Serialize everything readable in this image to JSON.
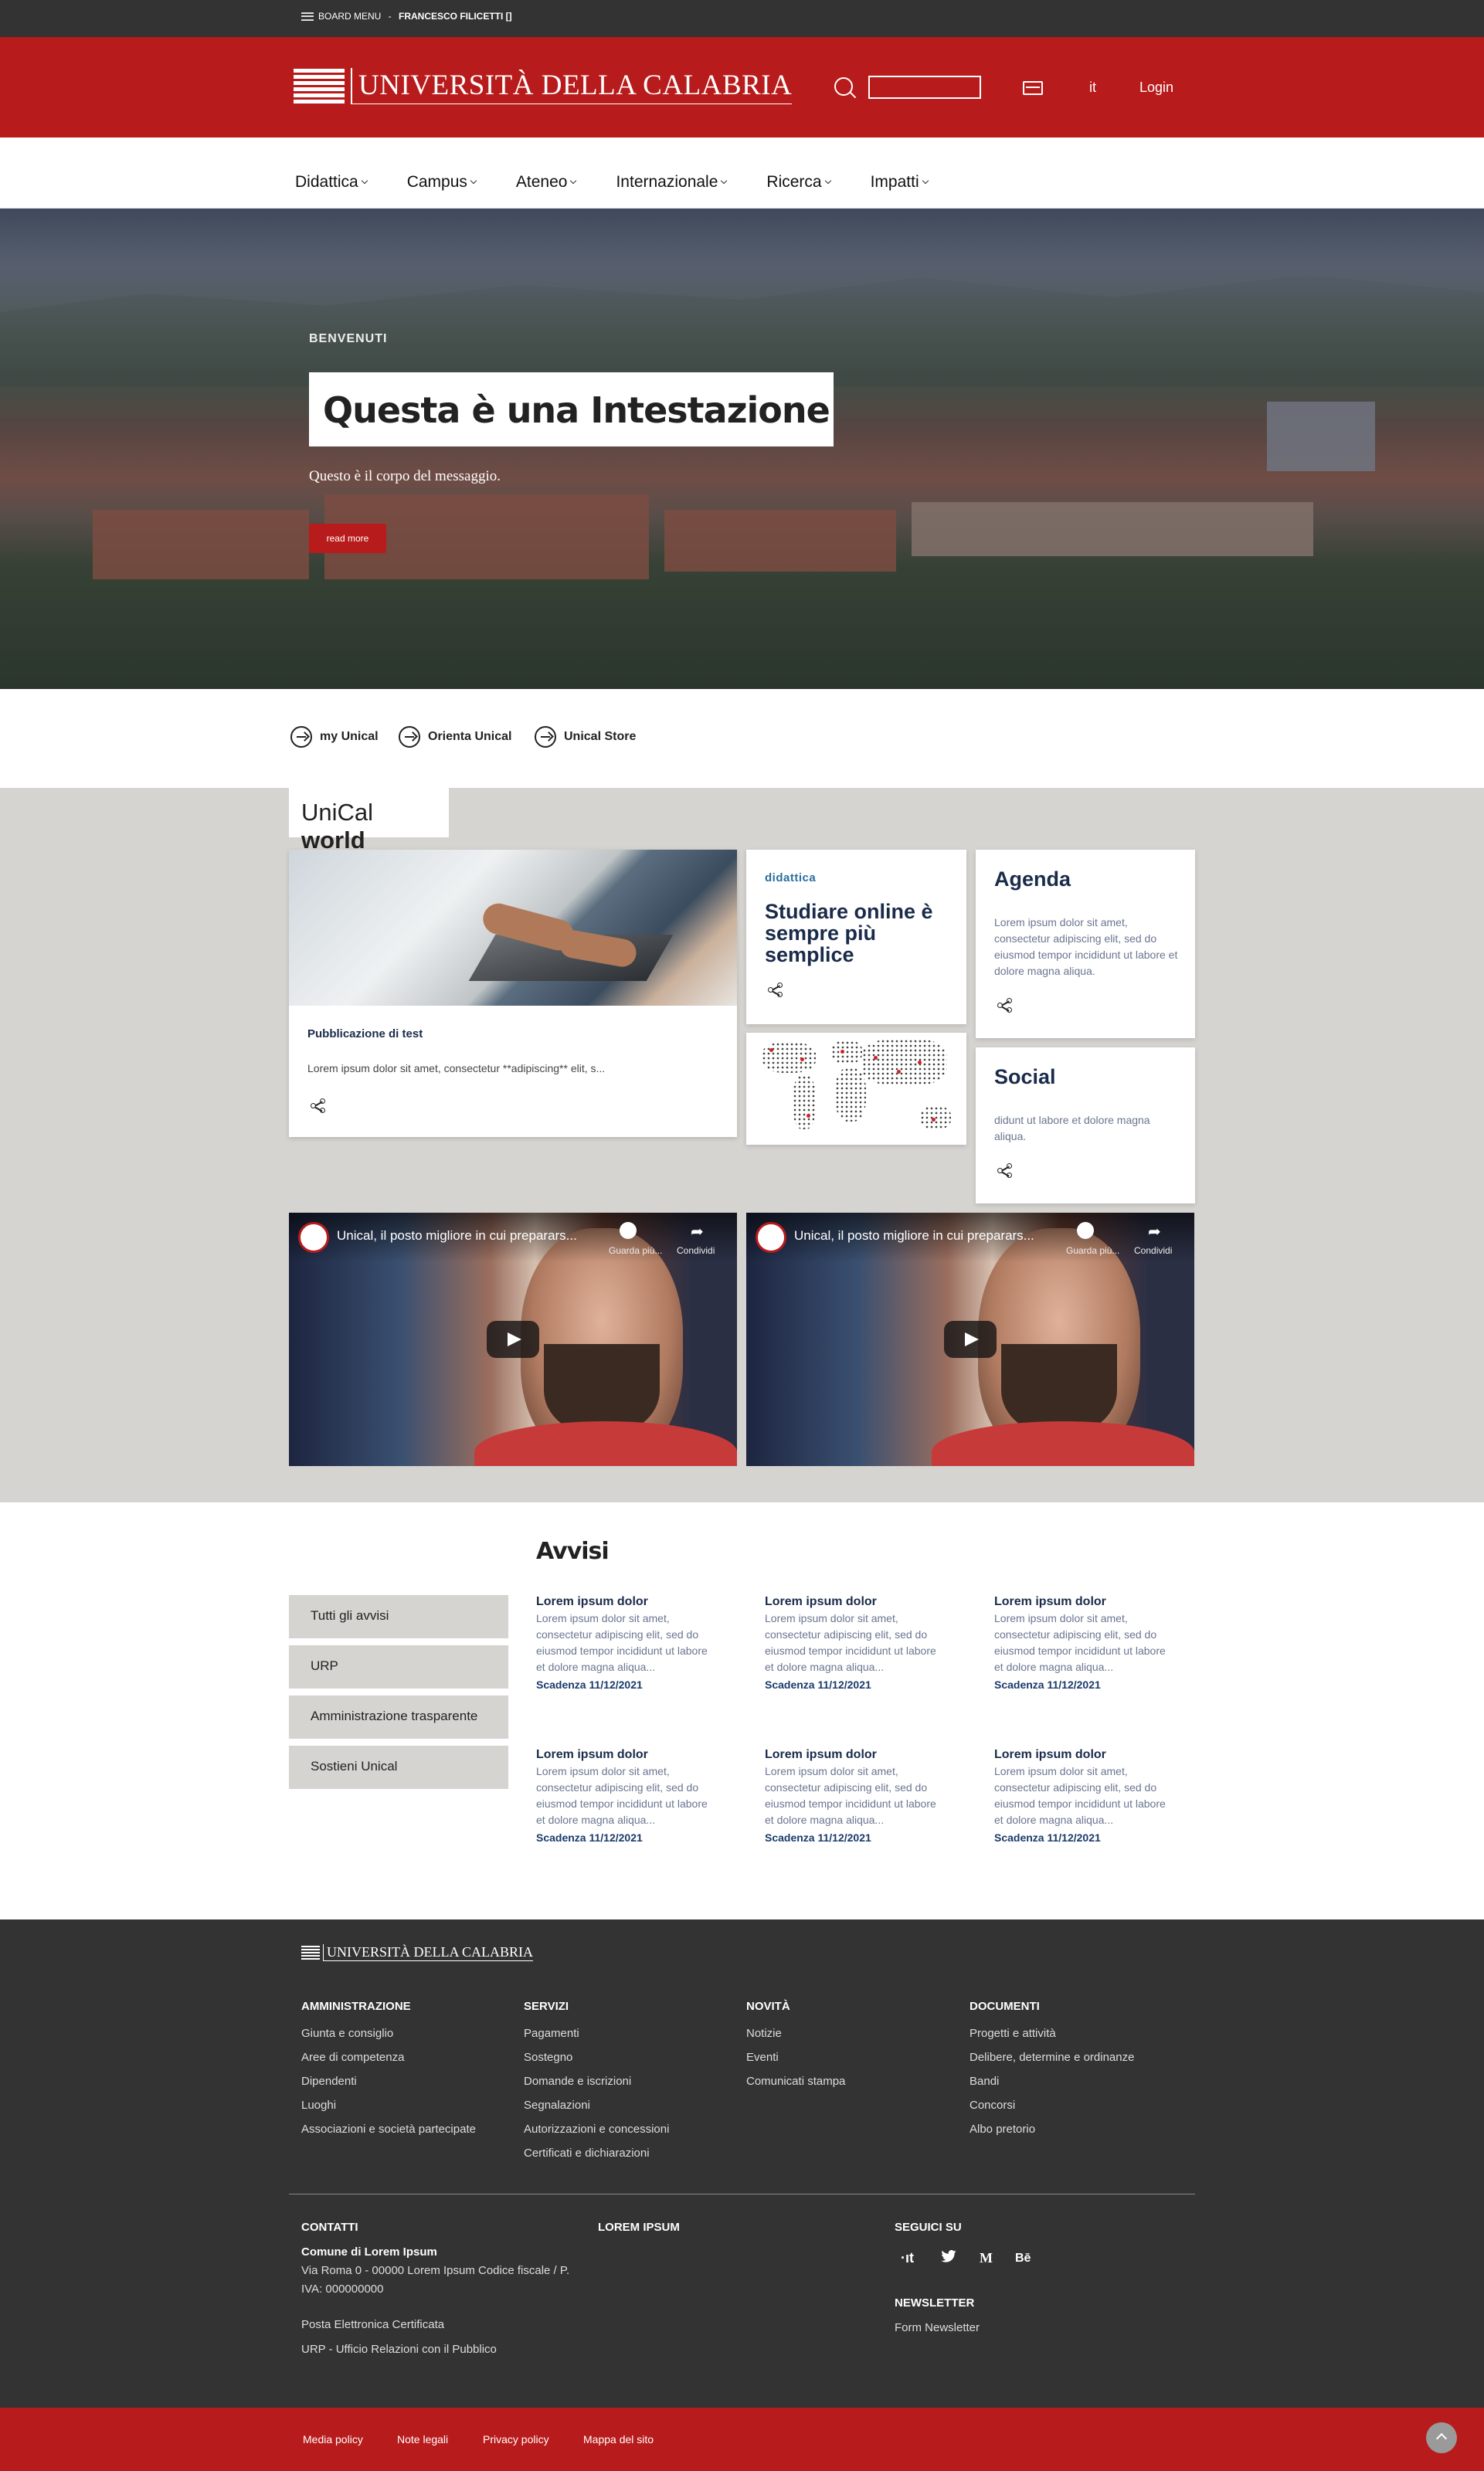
{
  "topbar": {
    "menu_label": "BOARD MENU",
    "separator": " - ",
    "user": "FRANCESCO FILICETTI []"
  },
  "header": {
    "brand": "UNIVERSITÀ DELLA CALABRIA",
    "search_placeholder": "",
    "lang": "it",
    "login": "Login"
  },
  "nav": {
    "items": [
      "Didattica",
      "Campus",
      "Ateneo",
      "Internazionale",
      "Ricerca",
      "Impatti"
    ]
  },
  "hero": {
    "kicker": "BENVENUTI",
    "title": "Questa è una Intestazione",
    "body": "Questo è il corpo del messaggio.",
    "button": "read more"
  },
  "quick_links": [
    "my Unical",
    "Orienta Unical",
    "Unical Store"
  ],
  "world": {
    "title_light": "UniCal",
    "title_bold": "world",
    "card_pub": {
      "title": "Pubblicazione di test",
      "body": "Lorem ipsum dolor sit amet, consectetur **adipiscing** elit, s..."
    },
    "card_did": {
      "kicker": "didattica",
      "title": "Studiare online è sempre più semplice"
    },
    "card_agenda": {
      "title": "Agenda",
      "body": "Lorem ipsum dolor sit amet, consectetur adipiscing elit, sed do eiusmod tempor incididunt ut labore et dolore magna aliqua."
    },
    "card_social": {
      "title": "Social",
      "body": "didunt ut labore et dolore magna aliqua."
    },
    "videos": [
      {
        "title": "Unical, il posto migliore in cui preparars...",
        "watch": "Guarda più...",
        "share": "Condividi"
      },
      {
        "title": "Unical, il posto migliore in cui preparars...",
        "watch": "Guarda più...",
        "share": "Condividi"
      }
    ]
  },
  "avvisi": {
    "title": "Avvisi",
    "side": [
      "Tutti gli avvisi",
      "URP",
      "Amministrazione trasparente",
      "Sostieni Unical"
    ],
    "items": [
      {
        "title": "Lorem ipsum dolor",
        "body": "Lorem ipsum dolor sit amet, consectetur adipiscing elit, sed do eiusmod tempor incididunt ut labore et dolore magna aliqua...",
        "date": "Scadenza 11/12/2021"
      },
      {
        "title": "Lorem ipsum dolor",
        "body": "Lorem ipsum dolor sit amet, consectetur adipiscing elit, sed do eiusmod tempor incididunt ut labore et dolore magna aliqua...",
        "date": "Scadenza 11/12/2021"
      },
      {
        "title": "Lorem ipsum dolor",
        "body": "Lorem ipsum dolor sit amet, consectetur adipiscing elit, sed do eiusmod tempor incididunt ut labore et dolore magna aliqua...",
        "date": "Scadenza 11/12/2021"
      },
      {
        "title": "Lorem ipsum dolor",
        "body": "Lorem ipsum dolor sit amet, consectetur adipiscing elit, sed do eiusmod tempor incididunt ut labore et dolore magna aliqua...",
        "date": "Scadenza 11/12/2021"
      },
      {
        "title": "Lorem ipsum dolor",
        "body": "Lorem ipsum dolor sit amet, consectetur adipiscing elit, sed do eiusmod tempor incididunt ut labore et dolore magna aliqua...",
        "date": "Scadenza 11/12/2021"
      },
      {
        "title": "Lorem ipsum dolor",
        "body": "Lorem ipsum dolor sit amet, consectetur adipiscing elit, sed do eiusmod tempor incididunt ut labore et dolore magna aliqua...",
        "date": "Scadenza 11/12/2021"
      }
    ]
  },
  "footer": {
    "brand": "UNIVERSITÀ DELLA CALABRIA",
    "columns": [
      {
        "title": "AMMINISTRAZIONE",
        "links": [
          "Giunta e consiglio",
          "Aree di competenza",
          "Dipendenti",
          "Luoghi",
          "Associazioni e società partecipate"
        ]
      },
      {
        "title": "SERVIZI",
        "links": [
          "Pagamenti",
          "Sostegno",
          "Domande e iscrizioni",
          "Segnalazioni",
          "Autorizzazioni e concessioni",
          "Certificati e dichiarazioni"
        ]
      },
      {
        "title": "NOVITÀ",
        "links": [
          "Notizie",
          "Eventi",
          "Comunicati stampa"
        ]
      },
      {
        "title": "DOCUMENTI",
        "links": [
          "Progetti e attività",
          "Delibere, determine e ordinanze",
          "Bandi",
          "Concorsi",
          "Albo pretorio"
        ]
      }
    ],
    "contacts": {
      "title": "CONTATTI",
      "name": "Comune di Lorem Ipsum",
      "address": "Via Roma 0 - 00000 Lorem Ipsum Codice fiscale / P. IVA: 000000000",
      "pec": "Posta Elettronica Certificata",
      "urp": "URP - Ufficio Relazioni con il Pubblico"
    },
    "lorem_title": "LOREM IPSUM",
    "social": {
      "title": "SEGUICI SU",
      "icons": [
        "designers-italia-icon",
        "twitter-icon",
        "medium-icon",
        "behance-icon"
      ],
      "glyphs": [
        "·ıt",
        "🐦",
        "M",
        "Bē"
      ]
    },
    "newsletter": {
      "title": "NEWSLETTER",
      "link": "Form Newsletter"
    }
  },
  "bottom": {
    "links": [
      "Media policy",
      "Note legali",
      "Privacy policy",
      "Mappa del sito"
    ]
  },
  "colors": {
    "brand_red": "#b81b1b",
    "dark": "#333333",
    "gray_bg": "#d6d4d0",
    "navy": "#1a2b4a"
  }
}
